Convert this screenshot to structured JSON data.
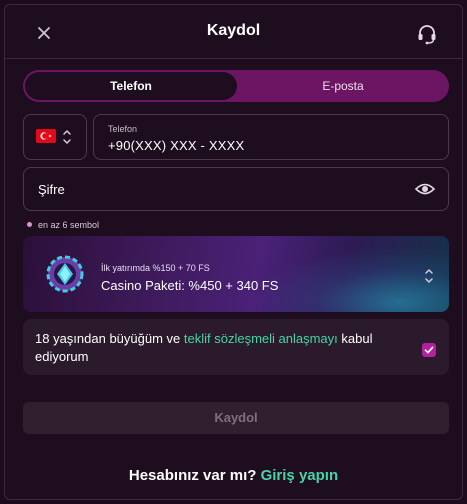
{
  "header": {
    "title": "Kaydol",
    "close_icon": "close-icon",
    "support_icon": "headset-icon"
  },
  "tabs": [
    {
      "label": "Telefon",
      "active": true
    },
    {
      "label": "E-posta",
      "active": false
    }
  ],
  "phone": {
    "country_flag": "turkey-flag",
    "label": "Telefon",
    "value": "+90(XXX) XXX - XXXX"
  },
  "password": {
    "placeholder": "Şifre",
    "icon": "eye-icon"
  },
  "hint": "en az 6 sembol",
  "bonus": {
    "small": "İlk yatırımda %150 + 70 FS",
    "main": "Casino Paketi: %450 + 340 FS"
  },
  "terms": {
    "before": "18 yaşından büyüğüm ve ",
    "link": "teklif sözleşmeli anlaşmayı",
    "after": " kabul ediyorum",
    "checked": true
  },
  "submit_label": "Kaydol",
  "footer": {
    "question": "Hesabınız var mı?",
    "link": "Giriş yapın"
  },
  "colors": {
    "accent": "#45d4a8",
    "brand": "#6c1563",
    "checkbox": "#b5209d",
    "background": "#1e0d1f"
  }
}
